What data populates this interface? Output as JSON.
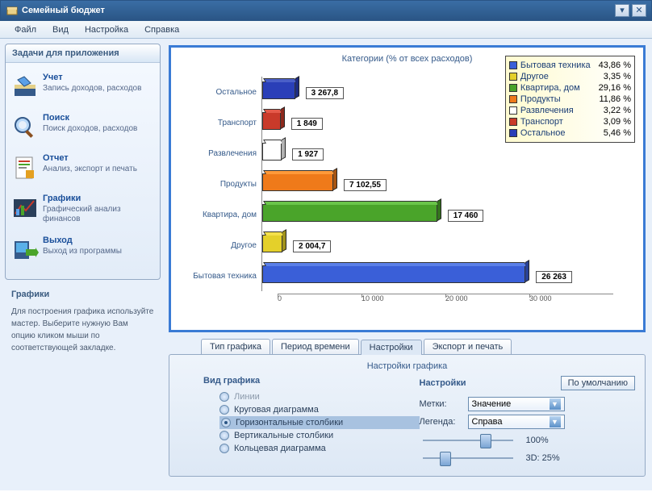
{
  "window": {
    "title": "Семейный бюджет"
  },
  "menu": {
    "file": "Файл",
    "view": "Вид",
    "settings": "Настройка",
    "help": "Справка"
  },
  "sidebar": {
    "header": "Задачи для приложения",
    "items": [
      {
        "title": "Учет",
        "desc": "Запись доходов, расходов"
      },
      {
        "title": "Поиск",
        "desc": "Поиск доходов, расходов"
      },
      {
        "title": "Отчет",
        "desc": "Анализ, экспорт и печать"
      },
      {
        "title": "Графики",
        "desc": "Графический анализ финансов"
      },
      {
        "title": "Выход",
        "desc": "Выход из программы"
      }
    ]
  },
  "help": {
    "title": "Графики",
    "text": "Для построения графика используйте мастер. Выберите нужную Вам опцию кликом мыши по соответствующей закладке."
  },
  "chart_data": {
    "type": "bar",
    "orientation": "horizontal",
    "title": "Категории (% от всех расходов)",
    "xlabel": "",
    "ylabel": "",
    "xlim": [
      0,
      36000
    ],
    "x_ticks": [
      0,
      10000,
      20000,
      30000
    ],
    "categories": [
      "Остальное",
      "Транспорт",
      "Развлечения",
      "Продукты",
      "Квартира, дом",
      "Другое",
      "Бытовая техника"
    ],
    "values": [
      3267.8,
      1849,
      1927,
      7102.55,
      17460,
      2004.7,
      26263
    ],
    "value_labels": [
      "3 267,8",
      "1 849",
      "1 927",
      "7 102,55",
      "17 460",
      "2 004,7",
      "26 263"
    ],
    "colors": [
      "#2a3fb8",
      "#c93a2a",
      "#ffffff",
      "#ef7a1a",
      "#4aa42a",
      "#e4d02a",
      "#3a5fd8"
    ],
    "legend_position": "right",
    "legend": [
      {
        "name": "Бытовая техника",
        "pct": "43,86 %",
        "color": "#3a5fd8"
      },
      {
        "name": "Другое",
        "pct": "3,35 %",
        "color": "#e4d02a"
      },
      {
        "name": "Квартира, дом",
        "pct": "29,16 %",
        "color": "#4aa42a"
      },
      {
        "name": "Продукты",
        "pct": "11,86 %",
        "color": "#ef7a1a"
      },
      {
        "name": "Развлечения",
        "pct": "3,22 %",
        "color": "#ffffff"
      },
      {
        "name": "Транспорт",
        "pct": "3,09 %",
        "color": "#c93a2a"
      },
      {
        "name": "Остальное",
        "pct": "5,46 %",
        "color": "#2a3fb8"
      }
    ]
  },
  "tabs": {
    "t0": "Тип графика",
    "t1": "Период времени",
    "t2": "Настройки",
    "t3": "Экспорт и печать",
    "title": "Настройки графика",
    "col_type": "Вид графика",
    "col_set": "Настройки",
    "default_btn": "По умолчанию",
    "radios": {
      "lines": "Линии",
      "pie": "Круговая диаграмма",
      "hbar": "Горизонтальные столбики",
      "vbar": "Вертикальные столбики",
      "ring": "Кольцевая диаграмма"
    },
    "labels_metki": "Метки:",
    "combo_value": "Значение",
    "labels_legend": "Легенда:",
    "combo_right": "Справа",
    "slider1": "100%",
    "slider2": "3D: 25%"
  },
  "x_tick_labels": {
    "t0": "0",
    "t1": "10 000",
    "t2": "20 000",
    "t3": "30 000"
  }
}
